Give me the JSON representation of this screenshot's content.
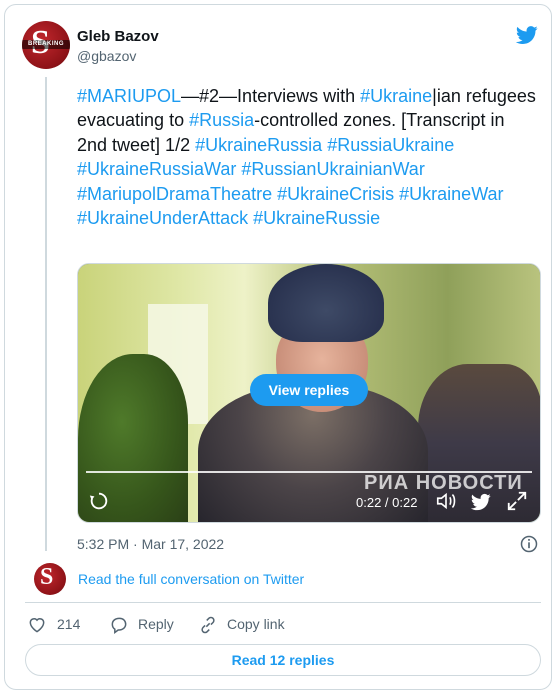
{
  "author": {
    "name": "Gleb Bazov",
    "handle": "@gbazov",
    "avatar_mark": "S",
    "avatar_band": "BREAKING"
  },
  "tweet": {
    "segments": [
      {
        "text": "#MARIUPOL",
        "tag": true
      },
      {
        "text": "—#2—Interviews with ",
        "tag": false
      },
      {
        "text": "#Ukraine",
        "tag": true
      },
      {
        "text": "|ian refugees evacuating to ",
        "tag": false
      },
      {
        "text": "#Russia",
        "tag": true
      },
      {
        "text": "-controlled zones. [Transcript in 2nd tweet] 1/2",
        "tag": false
      }
    ],
    "hashtags": [
      "#UkraineRussia",
      "#RussiaUkraine",
      "#UkraineRussiaWar",
      "#RussianUkrainianWar",
      "#MariupolDramaTheatre",
      "#UkraineCrisis",
      "#UkraineWar",
      "#UkraineUnderAttack",
      "#UkraineRussie"
    ]
  },
  "video": {
    "view_replies_label": "View replies",
    "time_display": "0:22 / 0:22",
    "watermark": "РИА НОВОСТИ",
    "progress": 1.0
  },
  "meta": {
    "timestamp": "5:32 PM · Mar 17, 2022",
    "read_full_conversation": "Read the full conversation on Twitter"
  },
  "actions": {
    "likes": "214",
    "reply_label": "Reply",
    "copy_link_label": "Copy link"
  },
  "footer": {
    "read_replies_label": "Read 12 replies"
  },
  "colors": {
    "accent": "#1d9bf0",
    "text": "#0f1419",
    "muted": "#536471",
    "border": "#cfd9de"
  },
  "icons": [
    "twitter-bird-icon",
    "replay-icon",
    "volume-icon",
    "fullscreen-icon",
    "info-icon",
    "heart-icon",
    "reply-icon",
    "link-icon"
  ]
}
